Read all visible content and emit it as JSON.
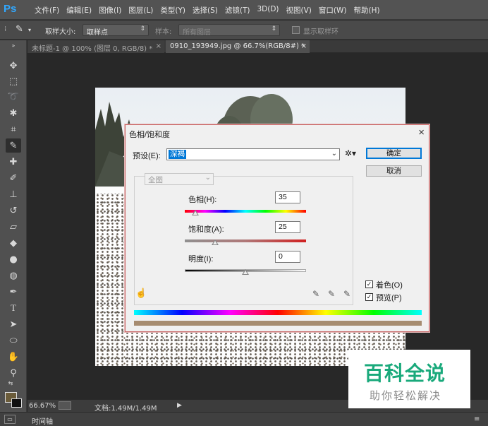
{
  "app": {
    "logo": "Ps"
  },
  "menu": [
    "文件(F)",
    "编辑(E)",
    "图像(I)",
    "图层(L)",
    "类型(Y)",
    "选择(S)",
    "滤镜(T)",
    "3D(D)",
    "视图(V)",
    "窗口(W)",
    "帮助(H)"
  ],
  "options": {
    "sample_size_label": "取样大小:",
    "sample_size_value": "取样点",
    "sample_label": "样本:",
    "sample_value": "所有图层",
    "show_ring_label": "显示取样环"
  },
  "tabs": [
    {
      "label": "未标题-1 @ 100% (图层 0, RGB/8) *",
      "close": "×"
    },
    {
      "label": "0910_193949.jpg @ 66.7%(RGB/8#) *",
      "close": "×"
    }
  ],
  "status": {
    "zoom": "66.67%",
    "doc_info": "文档:1.49M/1.49M",
    "timeline": "时间轴"
  },
  "dialog": {
    "title": "色相/饱和度",
    "close": "×",
    "preset_label": "预设(E):",
    "preset_value": "深褐",
    "ok_label": "确定",
    "cancel_label": "取消",
    "channel_value": "全图",
    "hue_label": "色相(H):",
    "hue_value": "35",
    "hue_level": 0.09,
    "saturation_label": "饱和度(A):",
    "saturation_value": "25",
    "saturation_level": 0.25,
    "lightness_label": "明度(I):",
    "lightness_value": "0",
    "lightness_level": 0.5,
    "colorize_label": "着色(O)",
    "colorize_checked": true,
    "preview_label": "预览(P)",
    "preview_checked": true,
    "colors": {
      "colorize_bar": "#a68c70",
      "border": "#c86464"
    }
  },
  "watermark": {
    "main": "百科全说",
    "sub": "助你轻松解决"
  }
}
